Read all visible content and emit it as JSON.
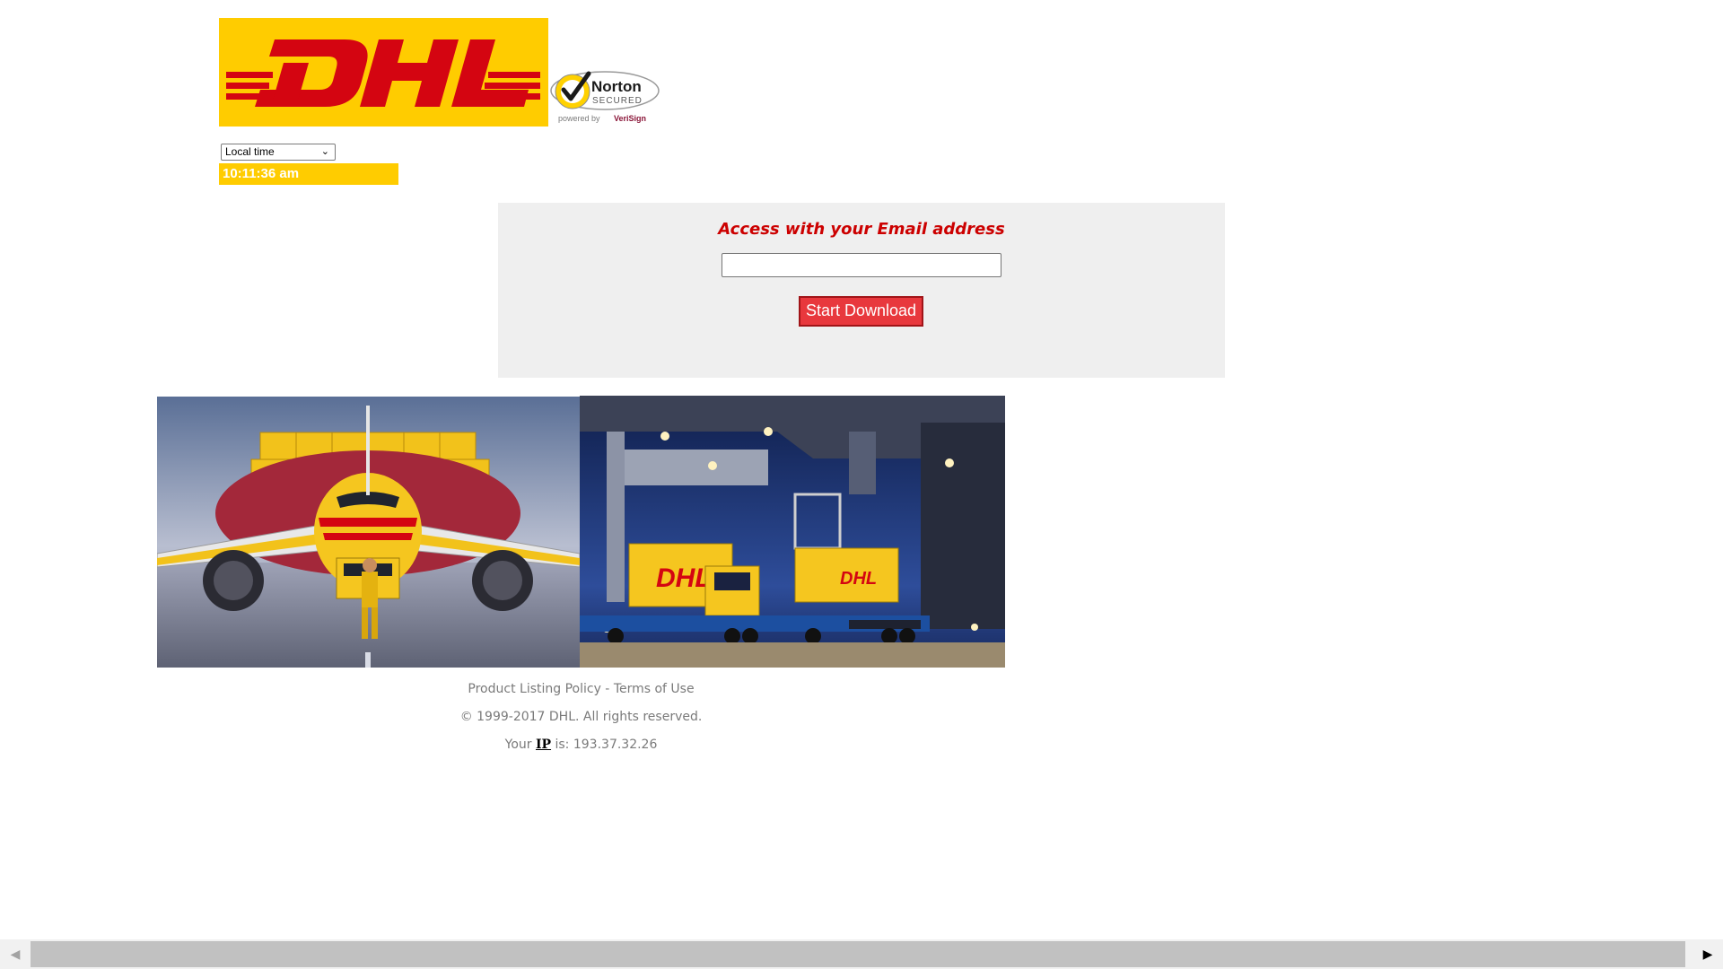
{
  "header": {
    "logo_text": "DHL",
    "norton_badge": {
      "brand": "Norton",
      "secured": "SECURED",
      "powered_by": "powered by",
      "powered_by_brand": "VeriSign"
    },
    "timezone_select": {
      "selected": "Local time"
    },
    "clock_time": "10:11:36 am"
  },
  "login": {
    "title": "Access with your Email address",
    "email_value": "",
    "email_placeholder": "",
    "download_button": "Start Download"
  },
  "photos": {
    "plane_icon": "dhl-cargo-plane-photo",
    "port_icon": "dhl-container-port-photo"
  },
  "footer": {
    "product_listing_policy": "Product Listing Policy",
    "separator": " - ",
    "terms_of_use": "Terms of Use",
    "copyright": "© 1999-2017 DHL. All rights reserved.",
    "ip_prefix": "Your ",
    "ip_link": "IP",
    "ip_middle": " is: ",
    "ip_value": "193.37.32.26"
  },
  "scrollbar": {
    "left_arrow_icon": "scroll-left-icon",
    "right_arrow_icon": "scroll-right-icon"
  },
  "colors": {
    "dhl_yellow": "#ffcc00",
    "dhl_red": "#d40511",
    "button_red": "#e8383d",
    "panel_bg": "#efefef",
    "title_red": "#cc0000",
    "footer_gray": "#7a7a7a"
  }
}
